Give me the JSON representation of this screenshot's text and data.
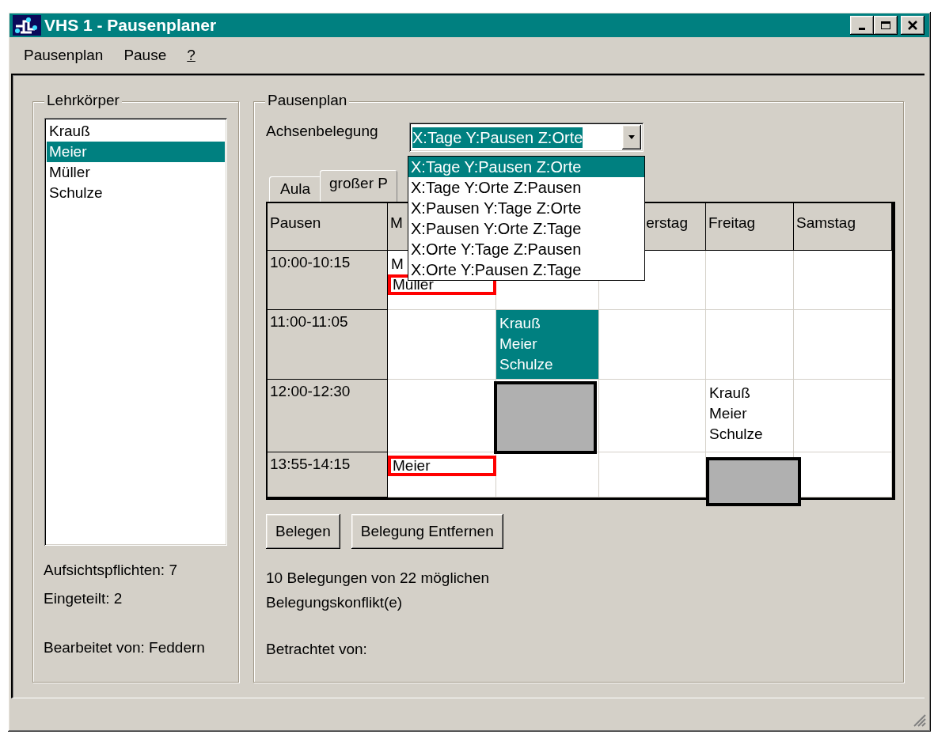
{
  "window": {
    "title": "VHS 1 - Pausenplaner"
  },
  "menu": [
    {
      "label": "Pausenplan",
      "underlined": false
    },
    {
      "label": "Pause",
      "underlined": false
    },
    {
      "label": "?",
      "underlined": true
    }
  ],
  "teachers": {
    "title": "Lehrkörper",
    "items": [
      {
        "name": "Krauß",
        "selected": false
      },
      {
        "name": "Meier",
        "selected": true
      },
      {
        "name": "Müller",
        "selected": false
      },
      {
        "name": "Schulze",
        "selected": false
      }
    ],
    "duties": "Aufsichtspflichten: 7",
    "assigned": "Eingeteilt: 2",
    "edited_by": "Bearbeitet von: Feddern"
  },
  "plan": {
    "title": "Pausenplan",
    "axis_label": "Achsenbelegung",
    "axis_value": "X:Tage Y:Pausen Z:Orte",
    "axis_options": [
      {
        "label": "X:Tage Y:Pausen Z:Orte",
        "selected": true
      },
      {
        "label": "X:Tage Y:Orte Z:Pausen",
        "selected": false
      },
      {
        "label": "X:Pausen Y:Tage Z:Orte",
        "selected": false
      },
      {
        "label": "X:Pausen Y:Orte Z:Tage",
        "selected": false
      },
      {
        "label": "X:Orte Y:Tage Z:Pausen",
        "selected": false
      },
      {
        "label": "X:Orte Y:Pausen Z:Tage",
        "selected": false
      }
    ],
    "tabs": [
      {
        "label": "Aula",
        "selected": false
      },
      {
        "label": "großer P",
        "selected": true
      }
    ],
    "columns": [
      {
        "label": "Pausen"
      },
      {
        "label": "M"
      },
      {},
      {
        "label": "erstag",
        "clipped": true
      },
      {
        "label": "Freitag"
      },
      {
        "label": "Samstag"
      }
    ],
    "rows": [
      {
        "cells": [
          {
            "kind": "time",
            "text": "10:00-10:15"
          },
          {
            "kind": "names",
            "selected": false,
            "entries": [
              {
                "text": "M",
                "conflict": false
              },
              {
                "text": "Muller",
                "conflict": true
              }
            ]
          },
          {
            "kind": "empty"
          },
          {
            "kind": "empty"
          },
          {
            "kind": "empty"
          },
          {
            "kind": "empty"
          }
        ]
      },
      {
        "cells": [
          {
            "kind": "time",
            "text": "11:00-11:05"
          },
          {
            "kind": "empty"
          },
          {
            "kind": "names",
            "selected": true,
            "entries": [
              {
                "text": "Krauß",
                "conflict": false
              },
              {
                "text": "Meier",
                "conflict": false
              },
              {
                "text": "Schulze",
                "conflict": false
              }
            ]
          },
          {
            "kind": "empty"
          },
          {
            "kind": "empty"
          },
          {
            "kind": "empty"
          }
        ]
      },
      {
        "cells": [
          {
            "kind": "time",
            "text": "12:00-12:30"
          },
          {
            "kind": "empty"
          },
          {
            "kind": "block"
          },
          {
            "kind": "empty"
          },
          {
            "kind": "names",
            "selected": false,
            "entries": [
              {
                "text": "Krauß",
                "conflict": false
              },
              {
                "text": "Meier",
                "conflict": false
              },
              {
                "text": "Schulze",
                "conflict": false
              }
            ]
          },
          {
            "kind": "empty"
          }
        ]
      },
      {
        "cells": [
          {
            "kind": "time",
            "text": "13:55-14:15"
          },
          {
            "kind": "names",
            "selected": false,
            "entries": [
              {
                "text": "Meier",
                "conflict": true
              }
            ]
          },
          {
            "kind": "empty"
          },
          {
            "kind": "empty"
          },
          {
            "kind": "block",
            "drop": true
          },
          {
            "kind": "empty"
          }
        ]
      }
    ],
    "buttons": [
      "Belegen",
      "Belegung Entfernen"
    ],
    "summary": "10 Belegungen von 22 möglichen",
    "conflicts": "Belegungskonflikt(e)",
    "viewed_by": "Betrachtet von:"
  }
}
